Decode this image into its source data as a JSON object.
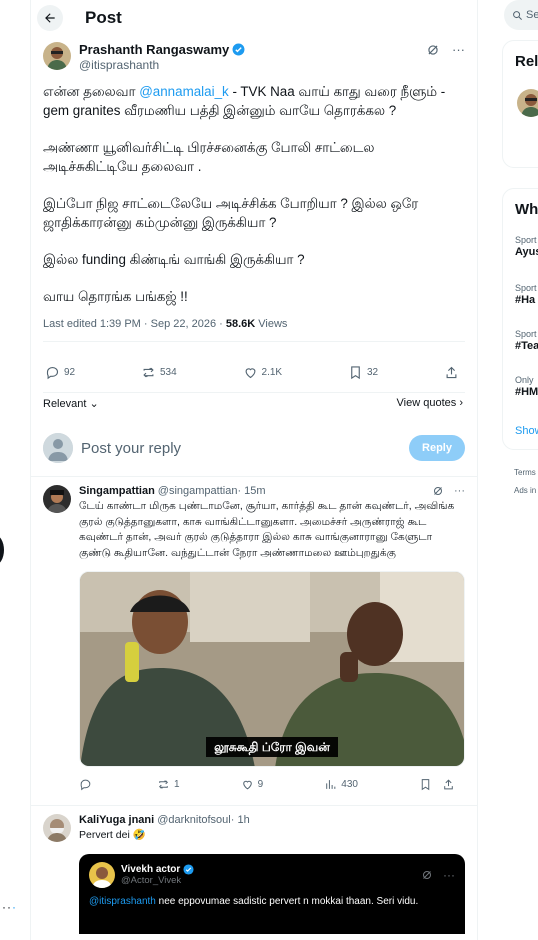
{
  "header": {
    "title": "Post"
  },
  "post": {
    "author_name": "Prashanth Rangaswamy",
    "author_handle": "@itisprashanth",
    "more": "···",
    "line1_pre": "என்ன தலைவா ",
    "line1_mention": "@annamalai_k",
    "line1_post": " - TVK Naa வாய் காது வரை நீளும் - gem granites வீரமணிய பத்தி இன்னும் வாயே தொரக்கல ?",
    "para2": "அண்ணா யூனிவர்சிட்டி பிரச்சனைக்கு போலி சாட்டைல அடிச்சுகிட்டியே  தலைவா .",
    "para3": "இப்போ நிஜ சாட்டைலேயே அடிச்சிக்க போறியா ? இல்ல ஒரே ஜாதிக்காரன்னு கம்முன்னு இருக்கியா ?",
    "para4": "இல்ல funding கிண்டிங் வாங்கி இருக்கியா ?",
    "para5": "வாய தொரங்க பங்கஜ் !!",
    "edited": "Last edited 1:39 PM · Sep 22, 2026 · ",
    "views_count": "58.6K",
    "views_label": " Views",
    "replies": "92",
    "reposts": "534",
    "likes": "2.1K",
    "bookmarks": "32",
    "sort_label": "Relevant",
    "view_quotes": "View quotes"
  },
  "reply_box": {
    "placeholder": "Post your reply",
    "button": "Reply"
  },
  "comments": [
    {
      "name": "Singampattian",
      "handle": "@singampattian",
      "time": " · 15m",
      "text": "டேய் காண்டா மிருக புண்டாமனே, சூர்யா, கார்த்தி கூட தான் கவுண்டர், அவிங்க குரல் குடுத்தானுகளா, காசு வாங்கிட்டானுகளா. அமைச்சர் அருண்ராஜ் கூட கவுண்டர் தான், அவர் குரல் குடுத்தாரா இல்ல காசு வாங்குனாரானு கேளுடா குண்டு கூதியானே. வந்துட்டான் நேரா அண்ணாமலை ஊம்புறதுக்கு",
      "caption": "லூசுகூதி ப்ரோ இவன்",
      "replies": "",
      "reposts": "1",
      "likes": "9",
      "views": "430"
    },
    {
      "name": "KaliYuga jnani",
      "handle": "@darknitofsoul",
      "time": " · 1h",
      "text": "Pervert dei 🤣",
      "quote_name": "Vivekh actor",
      "quote_handle": "@Actor_Vivek",
      "quote_mention": "@itisprashanth",
      "quote_text": " nee eppovumae sadistic pervert n mokkai thaan. Seri vidu."
    }
  ],
  "sidebar": {
    "search": "Se",
    "relevant_title": "Rel",
    "trending_title": "Wh",
    "trends": [
      {
        "cat": "Sport",
        "name": "Ayus"
      },
      {
        "cat": "Sport",
        "name": "#Ha"
      },
      {
        "cat": "Sport",
        "name": "#Tea"
      },
      {
        "cat": "Only",
        "name": "#HM"
      }
    ],
    "show_more": "Show",
    "terms": "Terms",
    "ads": "Ads in"
  },
  "left_rail": {
    "more": "··"
  },
  "colors": {
    "accent": "#1d9bf0",
    "text": "#0f1419",
    "muted": "#536471",
    "reply_disabled": "#8ecdf8"
  }
}
